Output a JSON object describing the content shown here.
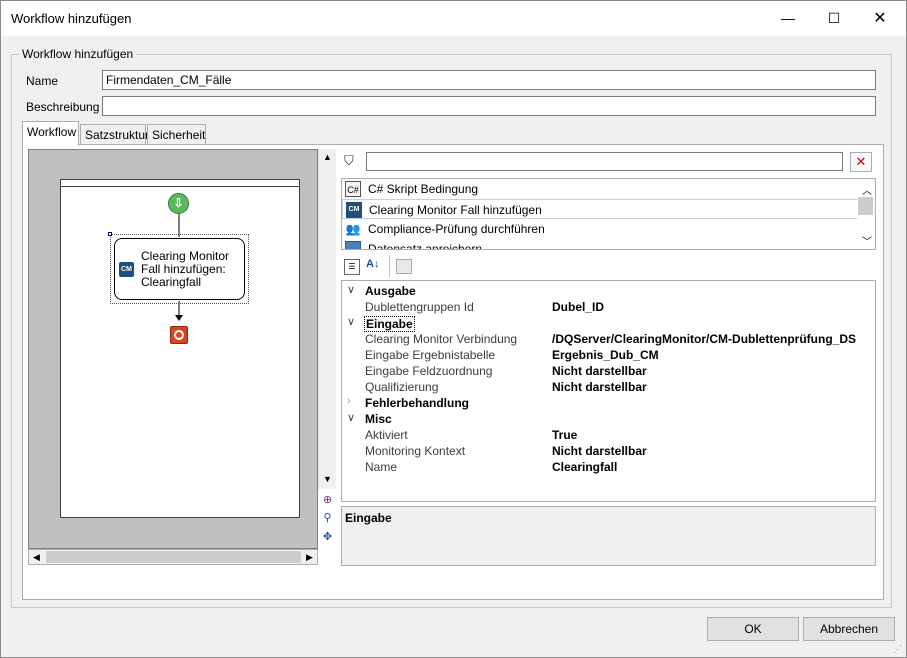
{
  "window": {
    "title": "Workflow hinzufügen",
    "minimize_label": "—",
    "maximize_label": "☐",
    "close_label": "✕"
  },
  "group": {
    "legend": "Workflow hinzufügen"
  },
  "form": {
    "name_label": "Name",
    "name_value": "Firmendaten_CM_Fälle",
    "beschreibung_label": "Beschreibung",
    "beschreibung_value": ""
  },
  "tabs": [
    {
      "label": "Workflow",
      "active": true
    },
    {
      "label": "Satzstruktur",
      "active": false
    },
    {
      "label": "Sicherheit",
      "active": false
    }
  ],
  "designer": {
    "node_label": "Clearing Monitor\nFall hinzufügen:\nClearingfall",
    "node_icon_text": "CM",
    "start_icon": "start-arrow-icon",
    "end_icon": "stop-icon"
  },
  "toolbox": {
    "filter_value": "",
    "items": [
      {
        "label": "C# Skript Bedingung",
        "icon": "script-icon",
        "selected": false
      },
      {
        "label": "Clearing Monitor Fall hinzufügen",
        "icon": "cm-icon",
        "selected": true
      },
      {
        "label": "Compliance-Prüfung durchführen",
        "icon": "users-icon",
        "selected": false
      },
      {
        "label": "Datensatz anreichern",
        "icon": "table-icon",
        "selected": false
      }
    ]
  },
  "properties": {
    "categories": [
      {
        "name": "Ausgabe",
        "expanded": true,
        "selected": false,
        "rows": [
          {
            "name": "Dublettengruppen Id",
            "value": "Dubel_ID"
          }
        ]
      },
      {
        "name": "Eingabe",
        "expanded": true,
        "selected": true,
        "rows": [
          {
            "name": "Clearing Monitor Verbindung",
            "value": "/DQServer/ClearingMonitor/CM-Dublettenprüfung_DS"
          },
          {
            "name": "Eingabe Ergebnistabelle",
            "value": "Ergebnis_Dub_CM"
          },
          {
            "name": "Eingabe Feldzuordnung",
            "value": "Nicht darstellbar"
          },
          {
            "name": "Qualifizierung",
            "value": "Nicht darstellbar"
          }
        ]
      },
      {
        "name": "Fehlerbehandlung",
        "expanded": false,
        "selected": false,
        "rows": []
      },
      {
        "name": "Misc",
        "expanded": true,
        "selected": false,
        "rows": [
          {
            "name": "Aktiviert",
            "value": "True"
          },
          {
            "name": "Monitoring Kontext",
            "value": "Nicht darstellbar"
          },
          {
            "name": "Name",
            "value": "Clearingfall"
          }
        ]
      }
    ],
    "description_title": "Eingabe"
  },
  "buttons": {
    "ok": "OK",
    "cancel": "Abbrechen"
  }
}
